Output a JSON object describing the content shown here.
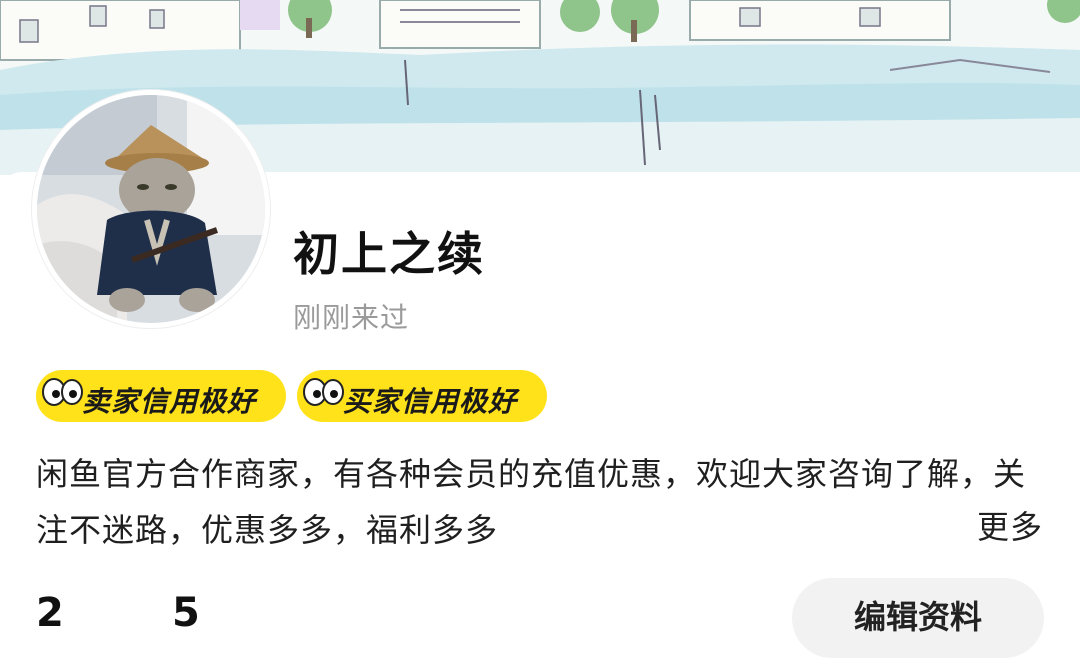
{
  "profile": {
    "username": "初上之续",
    "last_seen": "刚刚来过",
    "avatar_desc_icon": "cat-avatar"
  },
  "badges": [
    {
      "label": "卖家信用极好",
      "icon": "eyes-icon"
    },
    {
      "label": "买家信用极好",
      "icon": "eyes-icon"
    }
  ],
  "bio": {
    "text": "闲鱼官方合作商家，有各种会员的充值优惠，欢迎大家咨询了解，关注不迷路，优惠多多，福利多多",
    "more_label": "更多"
  },
  "stats": {
    "first_value": "2",
    "second_value": "5"
  },
  "actions": {
    "edit_label": "编辑资料"
  },
  "colors": {
    "badge": "#ffe21a",
    "text": "#1f1f1f",
    "muted": "#9a9a9a"
  }
}
